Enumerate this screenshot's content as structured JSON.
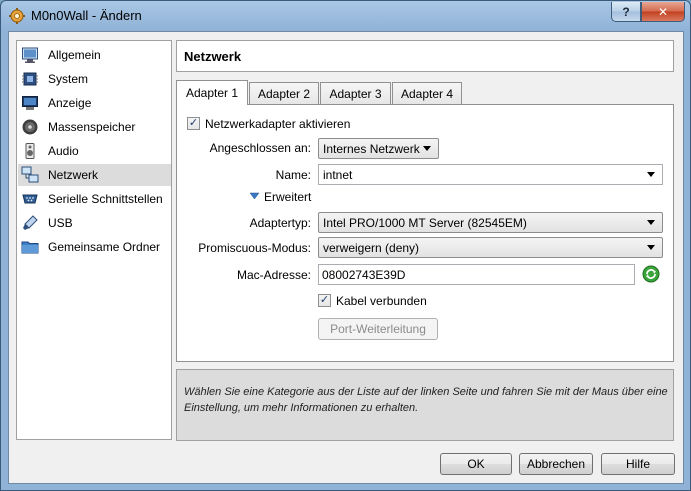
{
  "window": {
    "title": "M0n0Wall - Ändern",
    "help_label": "?",
    "close_label": "✕"
  },
  "sidebar": {
    "items": [
      {
        "label": "Allgemein",
        "icon": "monitor-icon"
      },
      {
        "label": "System",
        "icon": "chip-icon"
      },
      {
        "label": "Anzeige",
        "icon": "display-icon"
      },
      {
        "label": "Massenspeicher",
        "icon": "disk-icon"
      },
      {
        "label": "Audio",
        "icon": "speaker-icon"
      },
      {
        "label": "Netzwerk",
        "icon": "network-icon",
        "selected": true
      },
      {
        "label": "Serielle Schnittstellen",
        "icon": "serial-icon"
      },
      {
        "label": "USB",
        "icon": "usb-icon"
      },
      {
        "label": "Gemeinsame Ordner",
        "icon": "folder-icon"
      }
    ]
  },
  "header": {
    "title": "Netzwerk"
  },
  "tabs": [
    {
      "label": "Adapter 1",
      "active": true
    },
    {
      "label": "Adapter 2"
    },
    {
      "label": "Adapter 3"
    },
    {
      "label": "Adapter 4"
    }
  ],
  "form": {
    "enable_adapter": {
      "label": "Netzwerkadapter aktivieren",
      "checked": true
    },
    "attached_to": {
      "label": "Angeschlossen an:",
      "value": "Internes Netzwerk"
    },
    "name": {
      "label": "Name:",
      "value": "intnet"
    },
    "advanced": {
      "label": "Erweitert"
    },
    "adapter_type": {
      "label": "Adaptertyp:",
      "value": "Intel PRO/1000 MT Server (82545EM)"
    },
    "promiscuous": {
      "label": "Promiscuous-Modus:",
      "value": "verweigern (deny)"
    },
    "mac": {
      "label": "Mac-Adresse:",
      "value": "08002743E39D"
    },
    "cable_connected": {
      "label": "Kabel verbunden",
      "checked": true
    },
    "port_forwarding_label": "Port-Weiterleitung"
  },
  "info": {
    "text": "Wählen Sie eine Kategorie aus der Liste auf der linken Seite und fahren Sie mit der Maus über eine Einstellung, um mehr Informationen zu erhalten."
  },
  "buttons": {
    "ok": "OK",
    "cancel": "Abbrechen",
    "help": "Hilfe"
  },
  "colors": {
    "accent": "#3a78c4",
    "selection": "#dcdcdc",
    "refresh": "#2e9e2e"
  }
}
